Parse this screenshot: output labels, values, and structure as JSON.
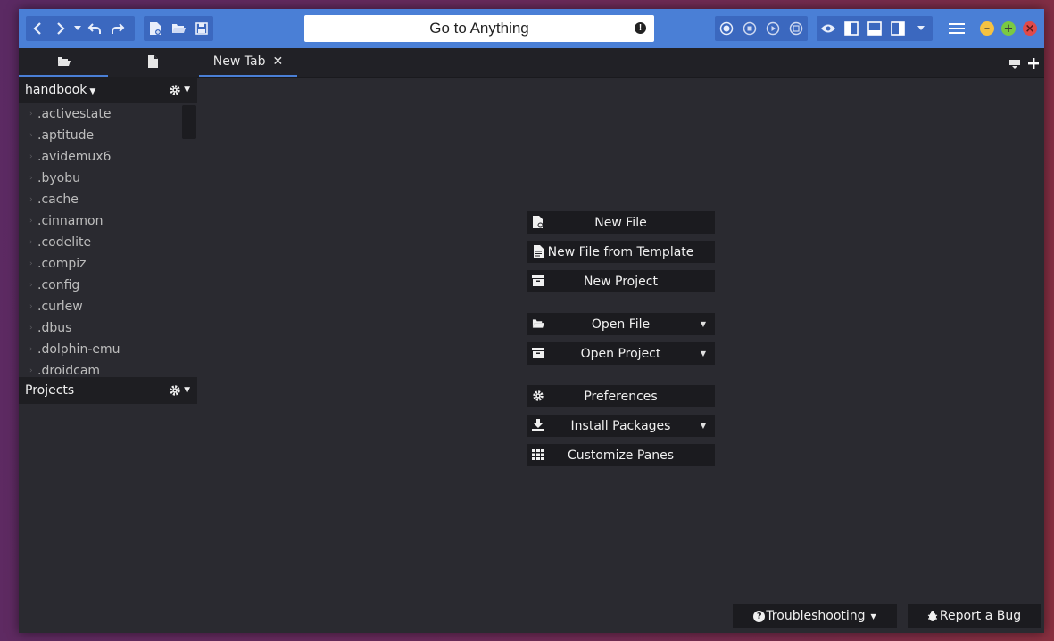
{
  "toolbar": {
    "goto_label": "Go to Anything",
    "icons": [
      "back-icon",
      "forward-icon",
      "history-dropdown-icon",
      "undo-icon",
      "redo-icon",
      "new-file-icon",
      "open-folder-icon",
      "save-icon",
      "record-icon",
      "stop-icon",
      "play-icon",
      "save-macro-icon",
      "eye-icon",
      "left-pane-icon",
      "bottom-pane-icon",
      "right-pane-icon",
      "layout-dropdown-icon",
      "hamburger-menu-icon"
    ]
  },
  "tabs": {
    "doc_tab_label": "New Tab"
  },
  "sidebar": {
    "place_title": "handbook",
    "projects_title": "Projects",
    "files": [
      ".activestate",
      ".aptitude",
      ".avidemux6",
      ".byobu",
      ".cache",
      ".cinnamon",
      ".codelite",
      ".compiz",
      ".config",
      ".curlew",
      ".dbus",
      ".dolphin-emu",
      ".droidcam"
    ]
  },
  "start_page": {
    "buttons": [
      {
        "label": "New File",
        "icon": "new-file-icon",
        "dropdown": false
      },
      {
        "label": "New File from Template",
        "icon": "template-icon",
        "dropdown": false
      },
      {
        "label": "New Project",
        "icon": "project-icon",
        "dropdown": false
      },
      {
        "label": "Open File",
        "icon": "open-folder-icon",
        "dropdown": true
      },
      {
        "label": "Open Project",
        "icon": "project-icon",
        "dropdown": true
      },
      {
        "label": "Preferences",
        "icon": "gear-icon",
        "dropdown": false
      },
      {
        "label": "Install Packages",
        "icon": "download-icon",
        "dropdown": true
      },
      {
        "label": "Customize Panes",
        "icon": "grid-icon",
        "dropdown": false
      }
    ]
  },
  "footer": {
    "troubleshooting_label": "Troubleshooting",
    "report_bug_label": "Report a Bug"
  },
  "colors": {
    "accent": "#4a7fd6",
    "window_bg": "#2a2a30",
    "button_bg": "#1b1b1f",
    "minimize": "#f5c242",
    "maximize": "#7ac943",
    "close": "#e04a4a"
  }
}
